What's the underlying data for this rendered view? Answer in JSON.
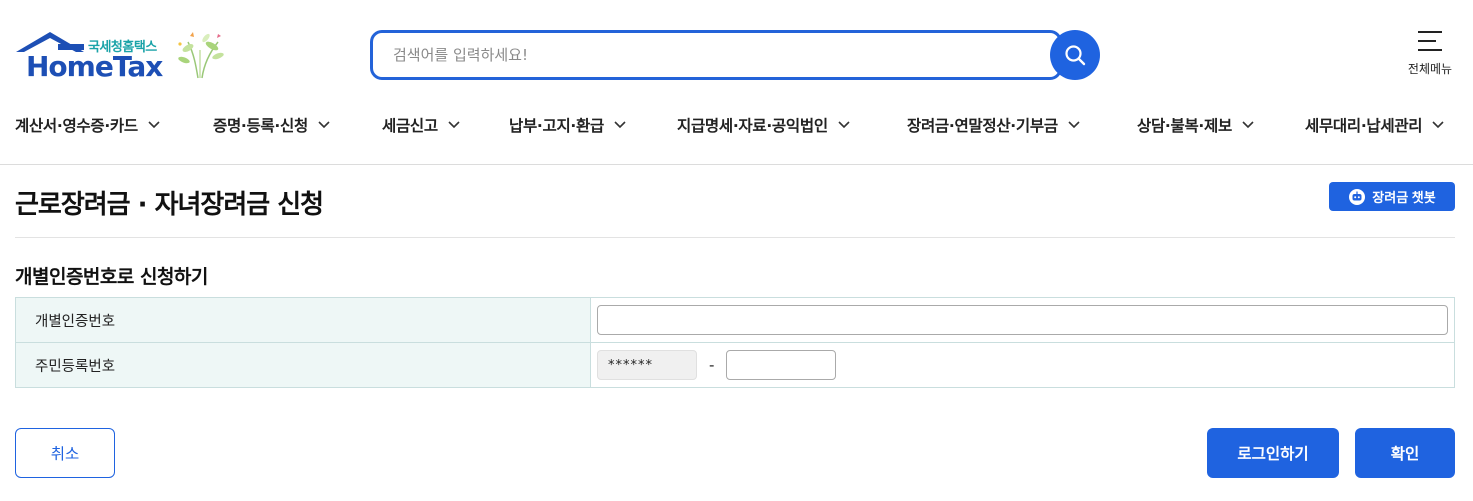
{
  "header": {
    "logo_sub": "국세청홈택스",
    "logo_main": "HomeTax",
    "search_placeholder": "검색어를 입력하세요!",
    "all_menu_label": "전체메뉴"
  },
  "gnb": [
    {
      "label": "계산서·영수증·카드"
    },
    {
      "label": "증명·등록·신청"
    },
    {
      "label": "세금신고"
    },
    {
      "label": "납부·고지·환급"
    },
    {
      "label": "지급명세·자료·공익법인"
    },
    {
      "label": "장려금·연말정산·기부금"
    },
    {
      "label": "상담·불복·제보"
    },
    {
      "label": "세무대리·납세관리"
    }
  ],
  "page": {
    "title": "근로장려금 · 자녀장려금 신청",
    "chatbot_label": "장려금 챗봇",
    "section_title": "개별인증번호로 신청하기"
  },
  "form": {
    "id_label": "개별인증번호",
    "id_value": "",
    "rrn_label": "주민등록번호",
    "rrn_front": "******",
    "rrn_dash": "-",
    "rrn_back": ""
  },
  "buttons": {
    "cancel": "취소",
    "login": "로그인하기",
    "confirm": "확인"
  },
  "colors": {
    "primary": "#1f63e0",
    "logo_blue": "#1d4fb5",
    "logo_teal": "#1aa3a8",
    "table_header_bg": "#eef7f6"
  }
}
